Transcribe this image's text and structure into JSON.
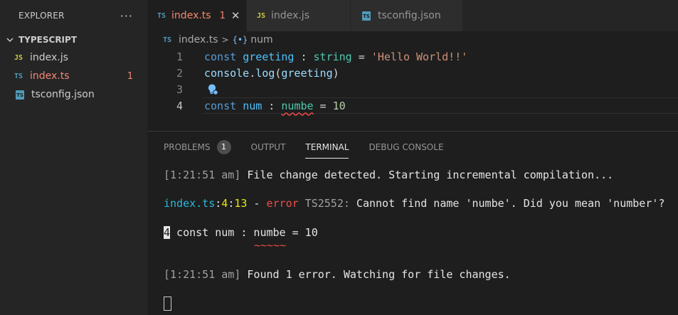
{
  "sidebar": {
    "title": "EXPLORER",
    "more_label": "···",
    "folder": "TYPESCRIPT",
    "files": [
      {
        "icon": "JS",
        "name": "index.js",
        "count": ""
      },
      {
        "icon": "TS",
        "name": "index.ts",
        "count": "1"
      },
      {
        "icon": "TS",
        "name": "tsconfig.json",
        "count": ""
      }
    ]
  },
  "tabs": [
    {
      "icon": "TS",
      "label": "index.ts",
      "problems": "1",
      "close": "✕"
    },
    {
      "icon": "JS",
      "label": "index.js"
    },
    {
      "icon": "TS",
      "label": "tsconfig.json"
    }
  ],
  "breadcrumb": {
    "file": "index.ts",
    "separator": ">",
    "symbol_icon": "{•}",
    "symbol": "num"
  },
  "editor": {
    "line_numbers": [
      "1",
      "2",
      "3",
      "4"
    ],
    "line1": {
      "kw": "const",
      "name": "greeting",
      "colon": " : ",
      "type": "string",
      "eq": " = ",
      "value": "'Hello World!!'"
    },
    "line2": {
      "obj": "console",
      "dot": ".",
      "method": "log",
      "open": "(",
      "arg": "greeting",
      "close": ")"
    },
    "line4": {
      "kw": "const",
      "name": "num",
      "colon": " : ",
      "type": "numbe",
      "eq": " = ",
      "value": "10"
    }
  },
  "panel": {
    "tabs": [
      {
        "label": "PROBLEMS",
        "badge": "1"
      },
      {
        "label": "OUTPUT"
      },
      {
        "label": "TERMINAL"
      },
      {
        "label": "DEBUG CONSOLE"
      }
    ],
    "terminal": {
      "line1": {
        "time": "[1:21:51 am]",
        "text": " File change detected. Starting incremental compilation..."
      },
      "line2": {
        "file": "index.ts",
        "c1": ":",
        "line": "4",
        "c2": ":",
        "col": "13",
        "dash": " - ",
        "err": "error",
        "code": " TS2552:",
        "msg": " Cannot find name 'numbe'. Did you mean 'number'?"
      },
      "line3": {
        "num": "4",
        "code": " const num : numbe = 10"
      },
      "squiggle": "~~~~~",
      "line4": {
        "time": "[1:21:51 am]",
        "text": " Found 1 error. Watching for file changes."
      }
    }
  }
}
